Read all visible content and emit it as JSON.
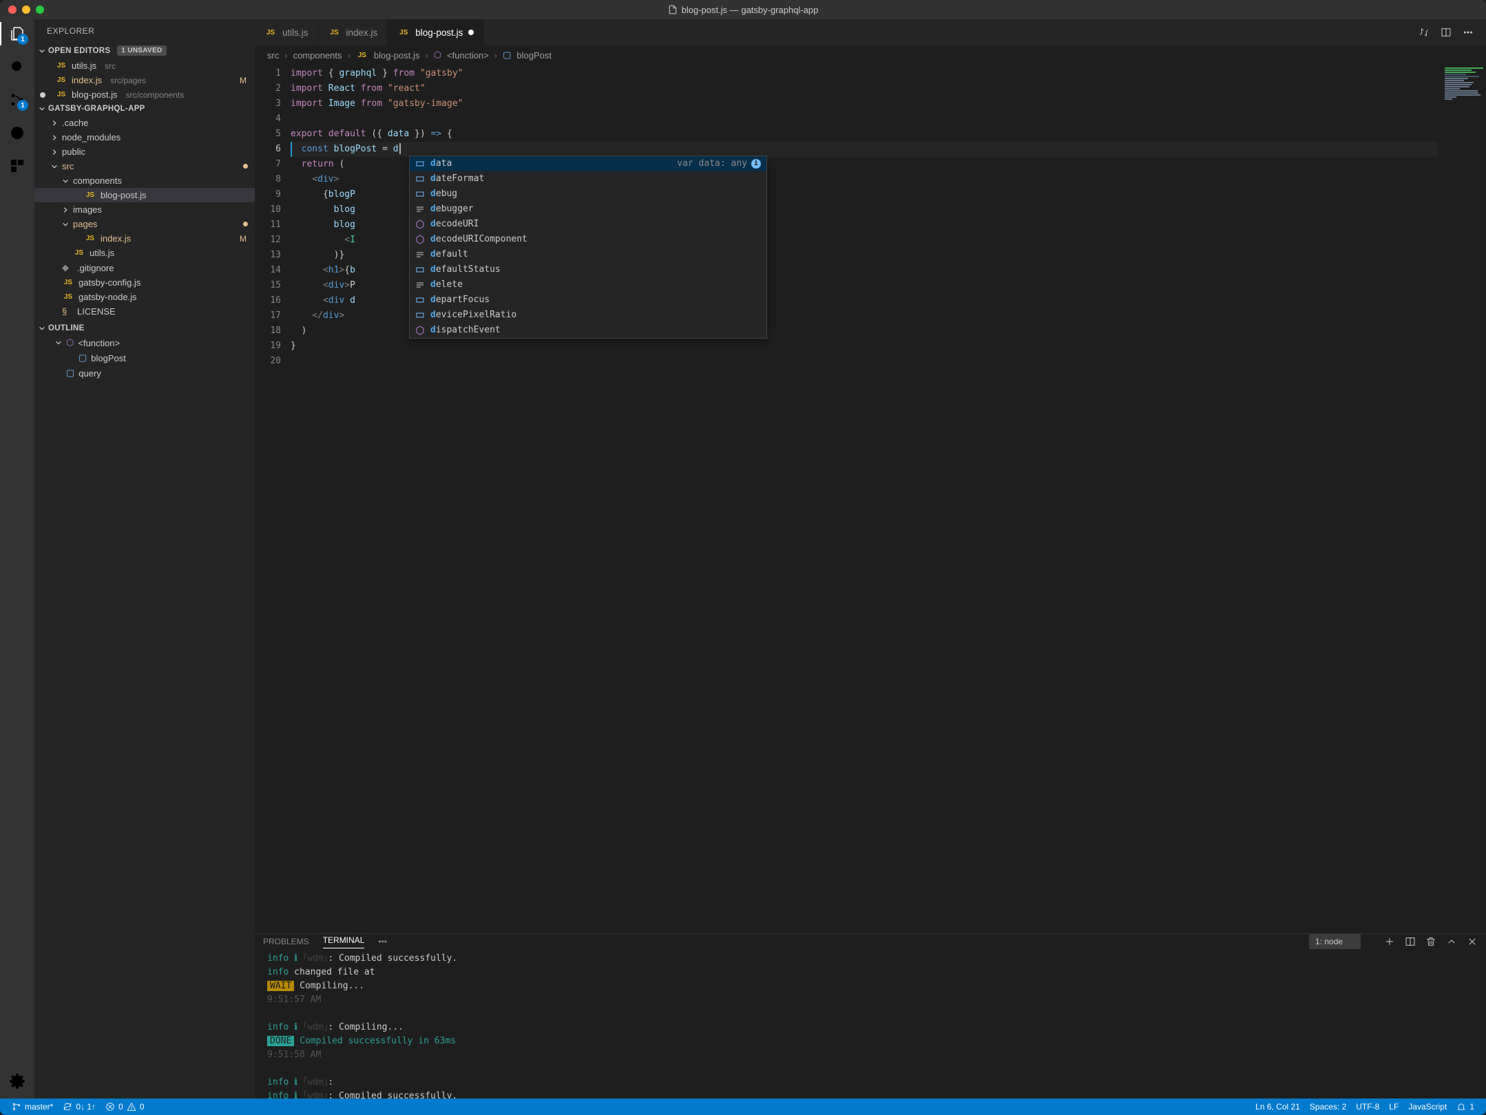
{
  "title": {
    "file": "blog-post.js",
    "project": "gatsby-graphql-app"
  },
  "activity": {
    "explorerBadge": "1",
    "scmBadge": "1"
  },
  "sidebar": {
    "title": "EXPLORER",
    "openEditors": {
      "label": "OPEN EDITORS",
      "unsaved": "1 UNSAVED",
      "items": [
        {
          "name": "utils.js",
          "path": "src",
          "js": true
        },
        {
          "name": "index.js",
          "path": "src/pages",
          "js": true,
          "mod": "M"
        },
        {
          "name": "blog-post.js",
          "path": "src/components",
          "js": true,
          "dirty": true
        }
      ]
    },
    "project": {
      "label": "GATSBY-GRAPHQL-APP",
      "tree": [
        {
          "type": "dir",
          "name": ".cache",
          "depth": 1
        },
        {
          "type": "dir",
          "name": "node_modules",
          "depth": 1
        },
        {
          "type": "dir",
          "name": "public",
          "depth": 1
        },
        {
          "type": "dir",
          "name": "src",
          "depth": 1,
          "open": true,
          "modDot": true,
          "orange": true
        },
        {
          "type": "dir",
          "name": "components",
          "depth": 2,
          "open": true
        },
        {
          "type": "file",
          "name": "blog-post.js",
          "depth": 3,
          "js": true,
          "active": true
        },
        {
          "type": "dir",
          "name": "images",
          "depth": 2
        },
        {
          "type": "dir",
          "name": "pages",
          "depth": 2,
          "open": true,
          "modDot": true,
          "orange": true
        },
        {
          "type": "file",
          "name": "index.js",
          "depth": 3,
          "js": true,
          "mod": "M",
          "orange": true
        },
        {
          "type": "file",
          "name": "utils.js",
          "depth": 2,
          "js": true
        },
        {
          "type": "file",
          "name": ".gitignore",
          "depth": 1,
          "git": true
        },
        {
          "type": "file",
          "name": "gatsby-config.js",
          "depth": 1,
          "js": true
        },
        {
          "type": "file",
          "name": "gatsby-node.js",
          "depth": 1,
          "js": true
        },
        {
          "type": "file",
          "name": "LICENSE",
          "depth": 1,
          "lic": true
        }
      ]
    },
    "outline": {
      "label": "OUTLINE",
      "items": [
        {
          "name": "<function>",
          "depth": 1,
          "icon": "cube"
        },
        {
          "name": "blogPost",
          "depth": 2,
          "icon": "var"
        },
        {
          "name": "query",
          "depth": 1,
          "icon": "var"
        }
      ]
    }
  },
  "tabs": [
    {
      "name": "utils.js",
      "js": true
    },
    {
      "name": "index.js",
      "js": true
    },
    {
      "name": "blog-post.js",
      "js": true,
      "active": true,
      "dirty": true
    }
  ],
  "breadcrumb": [
    "src",
    "components",
    "blog-post.js",
    "<function>",
    "blogPost"
  ],
  "editor": {
    "lines": 20,
    "cursorLine": 6
  },
  "suggest": {
    "detail": "var data: any",
    "items": [
      {
        "icon": "var",
        "label": "data",
        "sel": true
      },
      {
        "icon": "var",
        "label": "dateFormat"
      },
      {
        "icon": "var",
        "label": "debug"
      },
      {
        "icon": "kw",
        "label": "debugger"
      },
      {
        "icon": "fn",
        "label": "decodeURI"
      },
      {
        "icon": "fn",
        "label": "decodeURIComponent"
      },
      {
        "icon": "kw",
        "label": "default"
      },
      {
        "icon": "var",
        "label": "defaultStatus"
      },
      {
        "icon": "kw",
        "label": "delete"
      },
      {
        "icon": "var",
        "label": "departFocus"
      },
      {
        "icon": "var",
        "label": "devicePixelRatio"
      },
      {
        "icon": "fn",
        "label": "dispatchEvent"
      }
    ]
  },
  "panel": {
    "tabs": [
      "PROBLEMS",
      "TERMINAL"
    ],
    "active": "TERMINAL",
    "select": "1: node",
    "terminal": {
      "line1_a": "info",
      "line1_b": "ℹ",
      "line1_c": "｢wdm｣",
      "line1_d": ": Compiled successfully.",
      "line2_a": "info",
      "line2_b": "changed file at",
      "line3_a": "WAIT",
      "line3_b": "Compiling...",
      "line4": "9:51:57 AM",
      "line5_a": "info",
      "line5_b": "ℹ",
      "line5_c": "｢wdm｣",
      "line5_d": ": Compiling...",
      "line6_a": "DONE",
      "line6_b": "Compiled successfully in 63ms",
      "line7": "9:51:58 AM",
      "line8_a": "info",
      "line8_b": "ℹ",
      "line8_c": "｢wdm｣",
      "line8_d": ":",
      "line9_a": "info",
      "line9_b": "ℹ",
      "line9_c": "｢wdm｣",
      "line9_d": ": Compiled successfully."
    }
  },
  "statusbar": {
    "branch": "master*",
    "sync": "0↓ 1↑",
    "errors": "0",
    "warnings": "0",
    "cursor": "Ln 6, Col 21",
    "spaces": "Spaces: 2",
    "encoding": "UTF-8",
    "eol": "LF",
    "lang": "JavaScript",
    "bell": "1"
  }
}
